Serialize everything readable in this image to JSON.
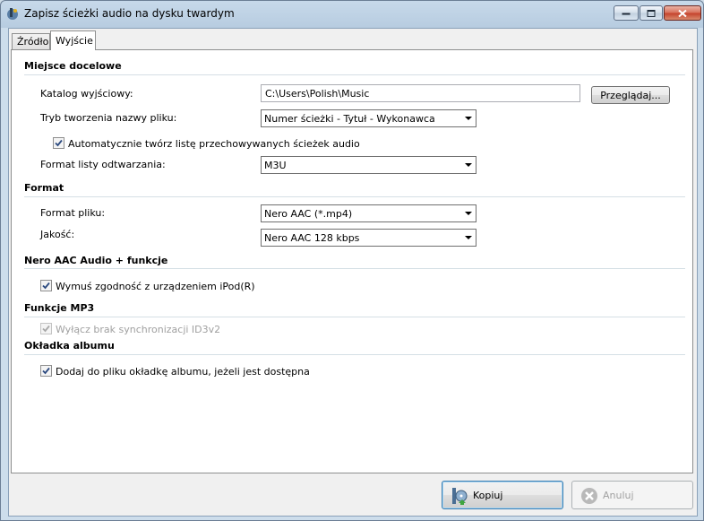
{
  "window": {
    "title": "Zapisz ścieżki audio na dysku twardym"
  },
  "tabs": [
    {
      "label": "Źródło"
    },
    {
      "label": "Wyjście"
    }
  ],
  "sections": {
    "destination": {
      "title": "Miejsce docelowe",
      "output_dir_label": "Katalog wyjściowy:",
      "output_dir_value": "C:\\Users\\Polish\\Music",
      "browse_label": "Przeglądaj...",
      "naming_label": "Tryb tworzenia nazwy pliku:",
      "naming_value": "Numer ścieżki - Tytuł - Wykonawca",
      "auto_playlist_label": "Automatycznie twórz listę przechowywanych ścieżek audio",
      "auto_playlist_checked": true,
      "playlist_format_label": "Format listy odtwarzania:",
      "playlist_format_value": "M3U"
    },
    "format": {
      "title": "Format",
      "file_format_label": "Format pliku:",
      "file_format_value": "Nero AAC (*.mp4)",
      "quality_label": "Jakość:",
      "quality_value": "Nero AAC 128 kbps"
    },
    "aac": {
      "title": "Nero AAC Audio + funkcje",
      "ipod_label": "Wymuś zgodność z urządzeniem iPod(R)",
      "ipod_checked": true
    },
    "mp3": {
      "title": "Funkcje MP3",
      "id3_label": "Wyłącz brak synchronizacji ID3v2",
      "id3_checked": true,
      "id3_disabled": true
    },
    "cover": {
      "title": "Okładka albumu",
      "add_cover_label": "Dodaj do pliku okładkę albumu, jeżeli jest dostępna",
      "add_cover_checked": true
    }
  },
  "footer": {
    "copy_label": "Kopiuj",
    "cancel_label": "Anuluj"
  },
  "colors": {
    "accent": "#3c7fb1",
    "section_line": "#d5dfe5",
    "disabled_text": "#a0a0a0"
  }
}
